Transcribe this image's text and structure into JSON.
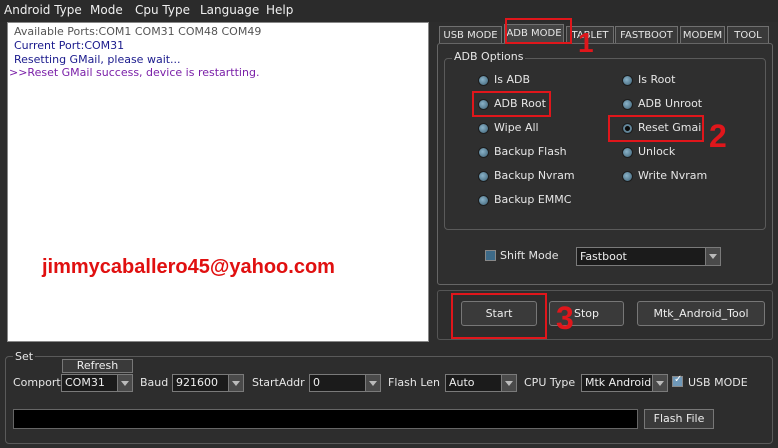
{
  "menu": [
    "Android Type",
    "Mode",
    "Cpu Type",
    "Language",
    "Help"
  ],
  "log": {
    "lines": [
      {
        "text": "Available Ports:COM1 COM31 COM48 COM49",
        "color": "#555555"
      },
      {
        "text": "Current Port:COM31",
        "color": "#1a1a8c"
      },
      {
        "text": "Resetting GMail, please wait...",
        "color": "#1a1a8c"
      },
      {
        "text": ">>Reset GMail success, device is restartting.",
        "color": "#7a1fa8"
      }
    ],
    "watermark": "jimmycaballero45@yahoo.com"
  },
  "tabs": [
    "USB MODE",
    "ADB MODE",
    "TABLET",
    "FASTBOOT",
    "MODEM",
    "TOOL"
  ],
  "active_tab": "ADB MODE",
  "adb_options": {
    "title": "ADB Options",
    "left": [
      "Is ADB",
      "ADB Root",
      "Wipe All",
      "Backup Flash",
      "Backup Nvram",
      "Backup EMMC"
    ],
    "right": [
      "Is Root",
      "ADB Unroot",
      "Reset Gmail",
      "Unlock",
      "Write Nvram"
    ],
    "selected": "Reset Gmail"
  },
  "shift_mode": {
    "label": "Shift Mode",
    "value": "Fastboot",
    "checked": false
  },
  "actions": {
    "start": "Start",
    "stop": "Stop",
    "tool": "Mtk_Android_Tool"
  },
  "annotations": [
    "1",
    "2",
    "3"
  ],
  "set": {
    "title": "Set",
    "refresh": "Refresh",
    "comport_label": "Comport",
    "comport": "COM31",
    "baud_label": "Baud",
    "baud": "921600",
    "startaddr_label": "StartAddr",
    "startaddr": "0",
    "flashlen_label": "Flash Len",
    "flashlen": "Auto",
    "cputype_label": "CPU Type",
    "cputype": "Mtk Android",
    "usbmode_label": "USB MODE",
    "usbmode_checked": true,
    "flash_file": "Flash File"
  },
  "colors": {
    "annotation": "#e0161b",
    "watermark": "#e01010",
    "background": "#2d2d2d"
  }
}
